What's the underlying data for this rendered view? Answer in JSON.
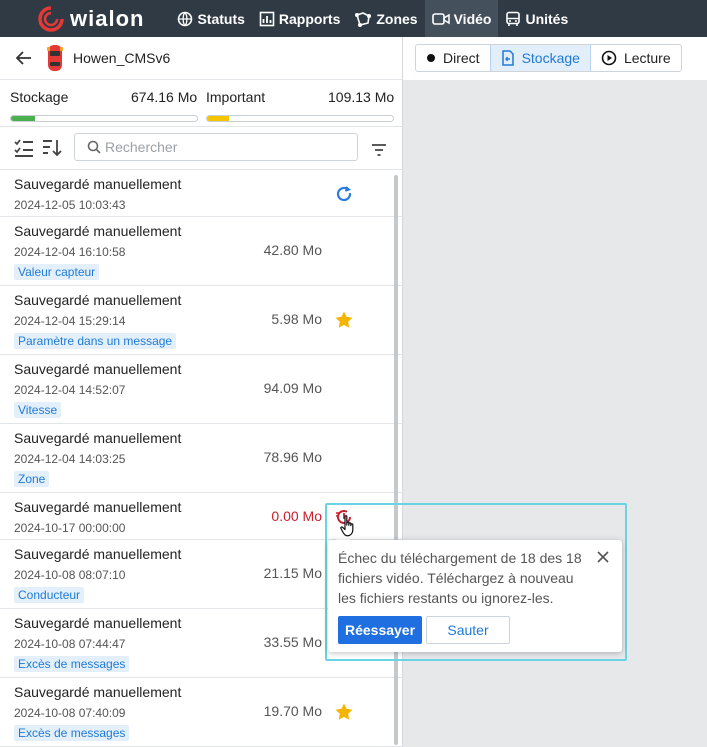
{
  "nav": {
    "logo_text": "wialon",
    "items": [
      {
        "label": "Statuts",
        "icon": "globe-icon"
      },
      {
        "label": "Rapports",
        "icon": "report-icon"
      },
      {
        "label": "Zones",
        "icon": "zones-icon"
      },
      {
        "label": "Vidéo",
        "icon": "video-icon",
        "active": true
      },
      {
        "label": "Unités",
        "icon": "bus-icon"
      }
    ]
  },
  "unit": {
    "name": "Howen_CMSv6"
  },
  "storage": {
    "storage_label": "Stockage",
    "storage_value": "674.16 Mo",
    "storage_fill": 0.13,
    "important_label": "Important",
    "important_value": "109.13 Mo",
    "important_fill": 0.12,
    "colors": {
      "storage": "#4caf50",
      "important": "#f5c400"
    }
  },
  "search": {
    "placeholder": "Rechercher"
  },
  "tabs": [
    {
      "label": "Direct",
      "icon": "dot-icon"
    },
    {
      "label": "Stockage",
      "icon": "storage-icon",
      "active": true
    },
    {
      "label": "Lecture",
      "icon": "play-icon"
    }
  ],
  "items": [
    {
      "title": "Sauvegardé manuellement",
      "date": "2024-12-05 10:03:43",
      "size": "",
      "tag": "",
      "action": "loading-icon"
    },
    {
      "title": "Sauvegardé manuellement",
      "date": "2024-12-04 16:10:58",
      "size": "42.80 Mo",
      "tag": "Valeur capteur",
      "action": ""
    },
    {
      "title": "Sauvegardé manuellement",
      "date": "2024-12-04 15:29:14",
      "size": "5.98 Mo",
      "tag": "Paramètre dans un message",
      "action": "star-icon"
    },
    {
      "title": "Sauvegardé manuellement",
      "date": "2024-12-04 14:52:07",
      "size": "94.09 Mo",
      "tag": "Vitesse",
      "action": ""
    },
    {
      "title": "Sauvegardé manuellement",
      "date": "2024-12-04 14:03:25",
      "size": "78.96 Mo",
      "tag": "Zone",
      "action": ""
    },
    {
      "title": "Sauvegardé manuellement",
      "date": "2024-10-17 00:00:00",
      "size": "0.00 Mo",
      "tag": "",
      "action": "error-retry-icon",
      "error": true
    },
    {
      "title": "Sauvegardé manuellement",
      "date": "2024-10-08 08:07:10",
      "size": "21.15 Mo",
      "tag": "Conducteur",
      "action": ""
    },
    {
      "title": "Sauvegardé manuellement",
      "date": "2024-10-08 07:44:47",
      "size": "33.55 Mo",
      "tag": "Excès de messages",
      "action": ""
    },
    {
      "title": "Sauvegardé manuellement",
      "date": "2024-10-08 07:40:09",
      "size": "19.70 Mo",
      "tag": "Excès de messages",
      "action": "star-icon"
    }
  ],
  "popup": {
    "message": "Échec du téléchargement de 18 des 18 fichiers vidéo. Téléchargez à nouveau les fichiers restants ou ignorez-les.",
    "retry_label": "Réessayer",
    "skip_label": "Sauter"
  }
}
